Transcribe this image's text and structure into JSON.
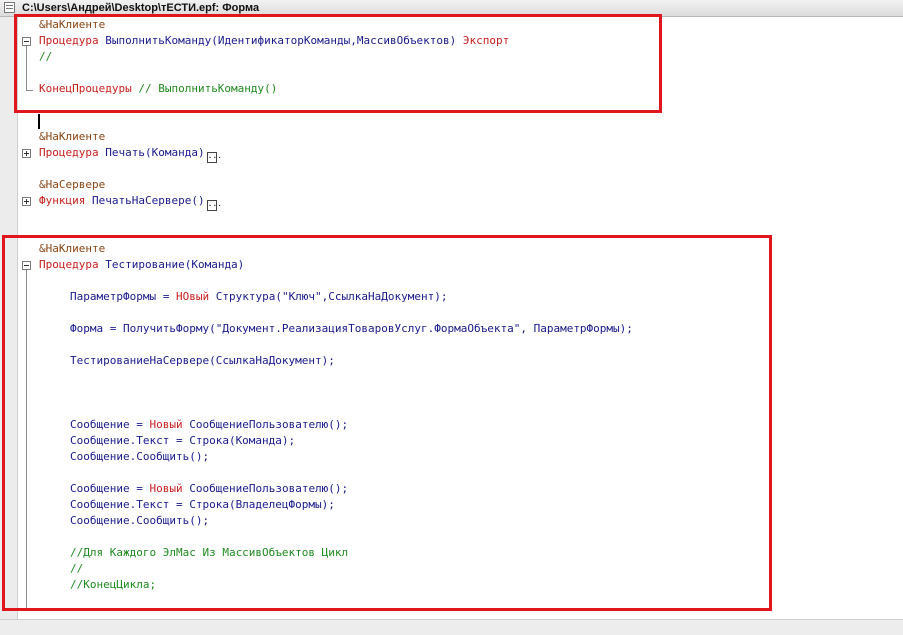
{
  "window": {
    "title": "C:\\Users\\Андрей\\Desktop\\тЕСТИ.epf: Форма"
  },
  "collapsed_marker": "...",
  "code": {
    "block1": {
      "directive": "&НаКлиенте",
      "proc_kw": "Процедура",
      "proc_sig": " ВыполнитьКоманду(ИдентификаторКоманды,МассивОбъектов) ",
      "export_kw": "Экспорт",
      "comment": "//",
      "end_kw": "КонецПроцедуры",
      "end_comment": " // ВыполнитьКоманду()"
    },
    "block2": {
      "directive": "&НаКлиенте",
      "proc_kw": "Процедура",
      "proc_sig": " Печать(Команда)"
    },
    "block3": {
      "directive": "&НаСервере",
      "func_kw": "Функция",
      "func_sig": " ПечатьНаСервере()"
    },
    "block4": {
      "directive": "&НаКлиенте",
      "proc_kw": "Процедура",
      "proc_sig": " Тестирование(Команда)",
      "l1_a": "ПараметрФормы = ",
      "l1_kw": "НОвый",
      "l1_b": " Структура(\"Ключ\",СсылкаНаДокумент);",
      "l2": "Форма = ПолучитьФорму(\"Документ.РеализацияТоваровУслуг.ФормаОбъекта\", ПараметрФормы);",
      "l3": "ТестированиеНаСервере(СсылкаНаДокумент);",
      "l4_a": "Сообщение = ",
      "l4_kw": "Новый",
      "l4_b": " СообщениеПользователю();",
      "l5": "Сообщение.Текст = Строка(Команда);",
      "l6": "Сообщение.Сообщить();",
      "l7_a": "Сообщение = ",
      "l7_kw": "Новый",
      "l7_b": " СообщениеПользователю();",
      "l8": "Сообщение.Текст = Строка(ВладелецФормы);",
      "l9": "Сообщение.Сообщить();",
      "c1": "//Для Каждого ЭлМас Из МассивОбъектов Цикл",
      "c2": "//",
      "c3": "//КонецЦикла;"
    }
  },
  "colors": {
    "keyword": "#c81e1e",
    "identifier": "#1a1a8c",
    "comment": "#1f8a1f",
    "directive": "#8b4513",
    "highlight_frame": "#e0151e"
  },
  "icons": {
    "window": "window-icon",
    "fold_open": "collapse-minus-icon",
    "fold_closed": "expand-plus-icon"
  }
}
